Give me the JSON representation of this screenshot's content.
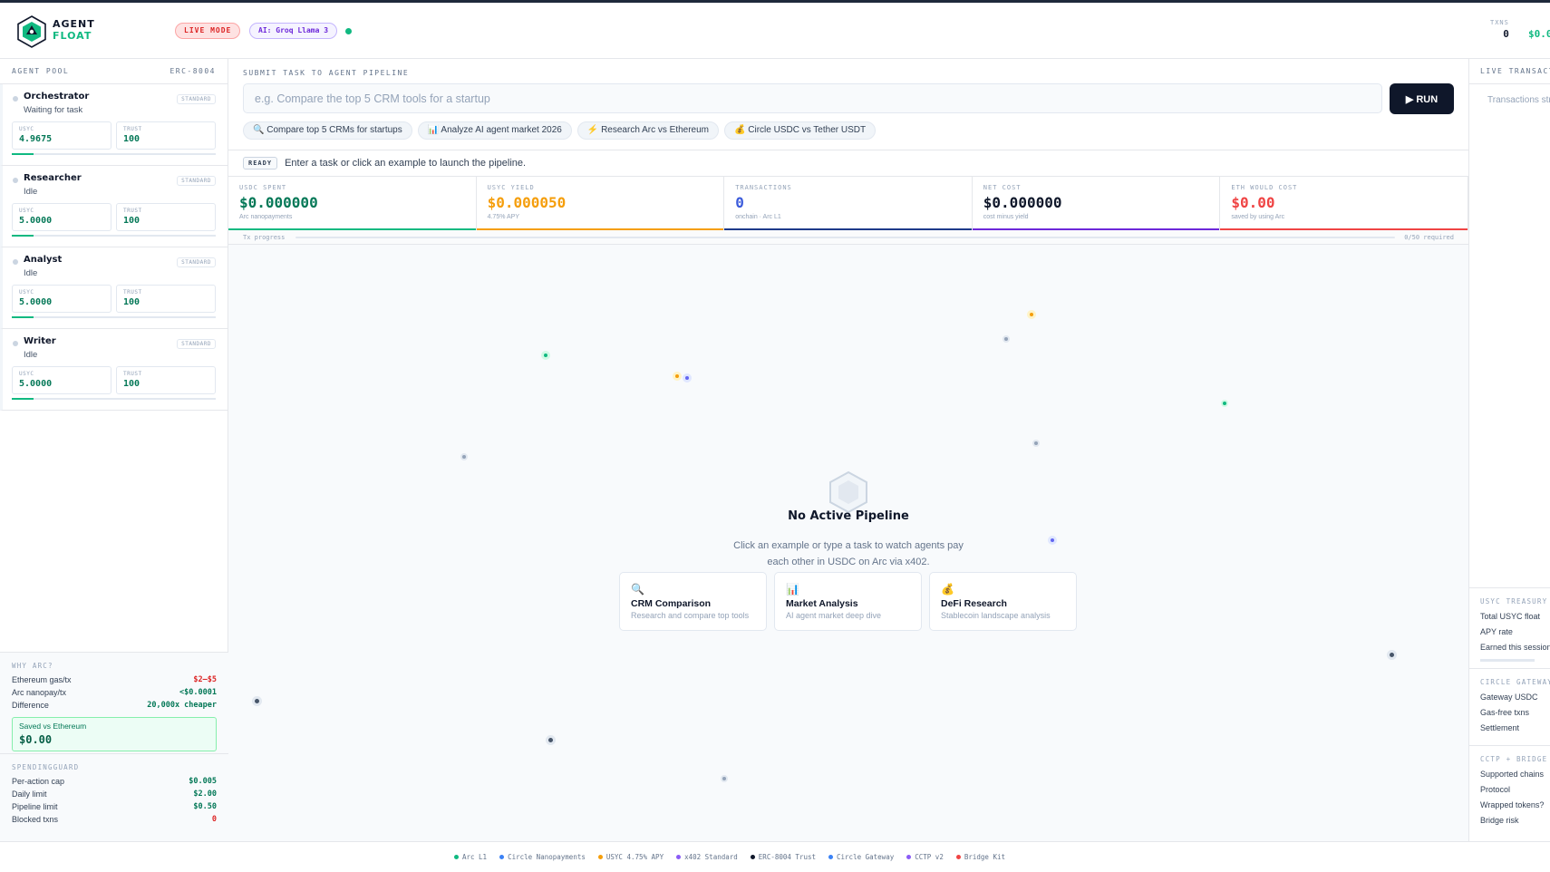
{
  "header": {
    "brand_line1": "AGENT",
    "brand_line2": "FLOAT",
    "live_mode": "LIVE MODE",
    "ai_badge": "AI: Groq Llama 3",
    "txns_label": "TXNS",
    "txns_value": "0",
    "usdc_value": "$0.0"
  },
  "sidebar": {
    "title": "AGENT POOL",
    "standard": "ERC-8004",
    "agents": [
      {
        "name": "Orchestrator",
        "state": "Waiting for task",
        "tag": "STANDARD",
        "usyc_label": "USYC",
        "usyc": "4.9675",
        "trust_label": "TRUST",
        "trust": "100"
      },
      {
        "name": "Researcher",
        "state": "Idle",
        "tag": "STANDARD",
        "usyc_label": "USYC",
        "usyc": "5.0000",
        "trust_label": "TRUST",
        "trust": "100"
      },
      {
        "name": "Analyst",
        "state": "Idle",
        "tag": "STANDARD",
        "usyc_label": "USYC",
        "usyc": "5.0000",
        "trust_label": "TRUST",
        "trust": "100"
      },
      {
        "name": "Writer",
        "state": "Idle",
        "tag": "STANDARD",
        "usyc_label": "USYC",
        "usyc": "5.0000",
        "trust_label": "TRUST",
        "trust": "100"
      }
    ],
    "why_arc": {
      "title": "WHY ARC?",
      "rows": [
        {
          "label": "Ethereum gas/tx",
          "value": "$2–$5",
          "color": "#dc2626"
        },
        {
          "label": "Arc nanopay/tx",
          "value": "<$0.0001",
          "color": "#047857"
        },
        {
          "label": "Difference",
          "value": "20,000x cheaper",
          "color": "#047857"
        }
      ],
      "saved_label": "Saved vs Ethereum",
      "saved_value": "$0.00"
    },
    "spending": {
      "title": "SPENDINGGUARD",
      "rows": [
        {
          "label": "Per-action cap",
          "value": "$0.005",
          "color": "#047857"
        },
        {
          "label": "Daily limit",
          "value": "$2.00",
          "color": "#047857"
        },
        {
          "label": "Pipeline limit",
          "value": "$0.50",
          "color": "#047857"
        },
        {
          "label": "Blocked txns",
          "value": "0",
          "color": "#dc2626"
        }
      ]
    }
  },
  "main": {
    "submit_label": "SUBMIT TASK TO AGENT PIPELINE",
    "input_placeholder": "e.g. Compare the top 5 CRM tools for a startup",
    "run_label": "▶ RUN",
    "examples": [
      {
        "icon": "🔍",
        "text": "Compare top 5 CRMs for startups"
      },
      {
        "icon": "📊",
        "text": "Analyze AI agent market 2026"
      },
      {
        "icon": "⚡",
        "text": "Research Arc vs Ethereum"
      },
      {
        "icon": "💰",
        "text": "Circle USDC vs Tether USDT"
      }
    ],
    "ready_badge": "READY",
    "ready_message": "Enter a task or click an example to launch the pipeline.",
    "stats": [
      {
        "label": "USDC SPENT",
        "value": "$0.000000",
        "sub": "Arc nanopayments",
        "color": "#047857",
        "underline": "#10b981"
      },
      {
        "label": "USYC YIELD",
        "value": "$0.000050",
        "sub": "4.75% APY",
        "color": "#f59e0b",
        "underline": "#f59e0b"
      },
      {
        "label": "TRANSACTIONS",
        "value": "0",
        "sub": "onchain · Arc L1",
        "color": "#3b5bdb",
        "underline": "#1e3a8a"
      },
      {
        "label": "NET COST",
        "value": "$0.000000",
        "sub": "cost minus yield",
        "color": "#0f172a",
        "underline": "#6d28d9"
      },
      {
        "label": "ETH WOULD COST",
        "value": "$0.00",
        "sub": "saved by using Arc",
        "color": "#ef4444",
        "underline": "#ef4444"
      }
    ],
    "progress": {
      "label": "Tx progress",
      "right": "0/50 required",
      "fraction": 0
    },
    "empty": {
      "title": "No Active Pipeline",
      "line1": "Click an example or type a task to watch agents pay",
      "line2": "each other in USDC on Arc via x402."
    },
    "cards": [
      {
        "icon": "🔍",
        "title": "CRM Comparison",
        "desc": "Research and compare top tools"
      },
      {
        "icon": "📊",
        "title": "Market Analysis",
        "desc": "AI agent market deep dive"
      },
      {
        "icon": "💰",
        "title": "DeFi Research",
        "desc": "Stablecoin landscape analysis"
      }
    ]
  },
  "right": {
    "title": "LIVE TRANSACTIONS",
    "empty": "Transactions stream here",
    "treasury": {
      "title": "USYC TREASURY",
      "rows": [
        "Total USYC float",
        "APY rate",
        "Earned this session"
      ]
    },
    "gateway": {
      "title": "CIRCLE GATEWAY",
      "rows": [
        "Gateway USDC",
        "Gas-free txns",
        "Settlement"
      ]
    },
    "cctp": {
      "title": "CCTP + BRIDGE KIT",
      "rows": [
        "Supported chains",
        "Protocol",
        "Wrapped tokens?",
        "Bridge risk"
      ]
    }
  },
  "footer": [
    {
      "label": "Arc L1",
      "color": "#10b981"
    },
    {
      "label": "Circle Nanopayments",
      "color": "#3b82f6"
    },
    {
      "label": "USYC 4.75% APY",
      "color": "#f59e0b"
    },
    {
      "label": "x402 Standard",
      "color": "#8b5cf6"
    },
    {
      "label": "ERC-8004 Trust",
      "color": "#0f172a"
    },
    {
      "label": "Circle Gateway",
      "color": "#3b82f6"
    },
    {
      "label": "CCTP v2",
      "color": "#8b5cf6"
    },
    {
      "label": "Bridge Kit",
      "color": "#ef4444"
    }
  ]
}
